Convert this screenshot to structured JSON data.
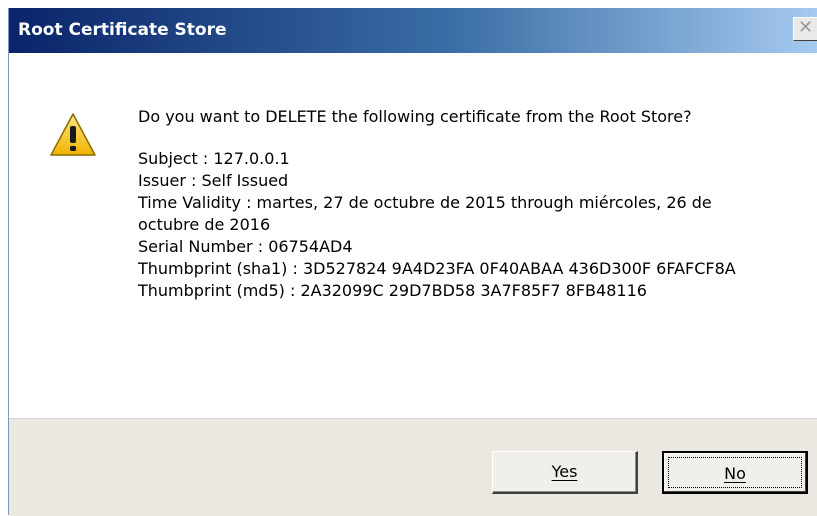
{
  "window": {
    "title": "Root Certificate Store",
    "close_symbol": "✕"
  },
  "icons": {
    "warning": "warning-triangle-icon",
    "close": "close-icon"
  },
  "message": {
    "question": "Do you want to DELETE the following certificate from the Root Store?",
    "details": [
      "Subject : 127.0.0.1",
      "Issuer : Self Issued",
      "Time Validity : martes, 27 de octubre de 2015 through miércoles, 26 de octubre de 2016",
      "Serial Number : 06754AD4",
      "Thumbprint (sha1) : 3D527824 9A4D23FA 0F40ABAA 436D300F 6FAFCF8A",
      "Thumbprint (md5) : 2A32099C 29D7BD58 3A7F85F7 8FB48116"
    ]
  },
  "buttons": {
    "yes": "Yes",
    "no": "No"
  },
  "colors": {
    "titlebar_start": "#0a246a",
    "titlebar_end": "#a6caf0",
    "footer_bg": "#eae8e1",
    "warning_fill": "#f5c400"
  }
}
